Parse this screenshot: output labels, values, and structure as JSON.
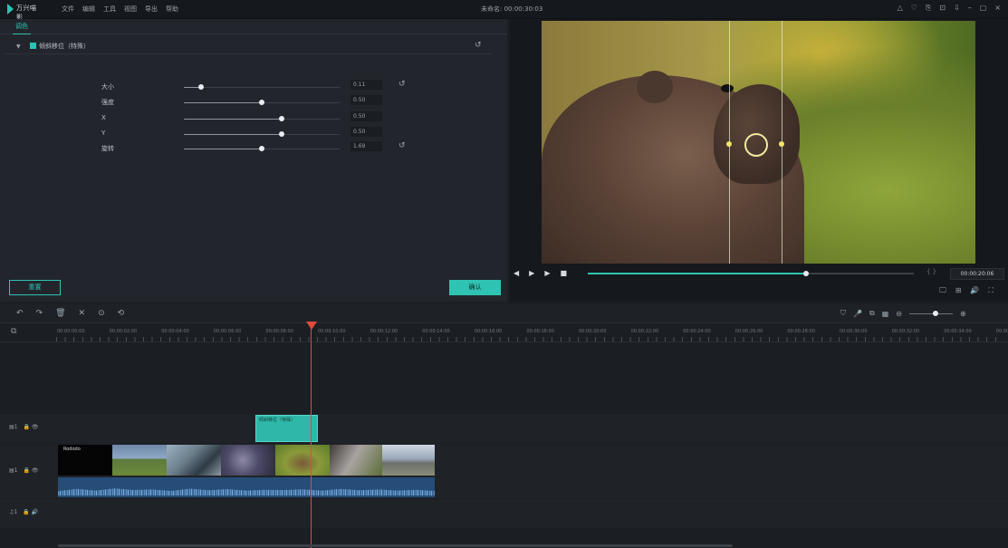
{
  "app": {
    "logo_text": "万兴喵影",
    "window_title": "未命名: 00:00:30:03"
  },
  "menu": [
    "文件",
    "编辑",
    "工具",
    "视图",
    "导出",
    "帮助"
  ],
  "window_controls": [
    "△",
    "♡",
    "⎘",
    "⊡",
    "⇩",
    "–",
    "▢",
    "×"
  ],
  "effect_panel": {
    "tab": "调色",
    "section_label": "倾斜移位（特殊）",
    "section_reset_icon": "reset-icon",
    "params": [
      {
        "label": "大小",
        "value": "0.11",
        "level": 0.11,
        "has_reset": true
      },
      {
        "label": "强度",
        "value": "0.50",
        "level": 0.5,
        "has_reset": false
      },
      {
        "label": "X",
        "value": "0.50",
        "level": 0.63,
        "has_reset": false
      },
      {
        "label": "Y",
        "value": "0.50",
        "level": 0.63,
        "has_reset": false
      },
      {
        "label": "旋转",
        "value": "1.69",
        "level": 0.5,
        "has_reset": true
      }
    ],
    "reset_button": "重置",
    "ok_button": "确认"
  },
  "preview": {
    "controls": [
      "◀",
      "▶",
      "▶",
      "■"
    ],
    "progress": 0.67,
    "bracket": "{ }",
    "timecode": "00:00:20:06",
    "bottom_icons": [
      "🖵",
      "⊞",
      "🔊",
      "⛶"
    ]
  },
  "timeline": {
    "tools_left": [
      "↶",
      "↷",
      "🗑",
      "✕",
      "⊙",
      "⟲"
    ],
    "tools_right": [
      "⛉",
      "🎤",
      "⧉",
      "▦",
      "⊖",
      "⊕"
    ],
    "ruler_icon": "⧉",
    "ruler_ticks": [
      "00:00:00:00",
      "00:00:02:00",
      "00:00:04:00",
      "00:00:06:00",
      "00:00:08:00",
      "00:00:10:00",
      "00:00:12:00",
      "00:00:14:00",
      "00:00:16:00",
      "00:00:18:00",
      "00:00:20:00",
      "00:00:22:00",
      "00:00:24:00",
      "00:00:26:00",
      "00:00:28:00",
      "00:00:30:00",
      "00:00:32:00",
      "00:00:34:00",
      "00:00:36:00"
    ],
    "tracks": [
      {
        "label": "▤1",
        "icons": "🔒 👁"
      },
      {
        "label": "▤1",
        "icons": "🔒 👁"
      },
      {
        "label": "♫1",
        "icons": "🔒 🔊"
      }
    ],
    "fx_clip_label": "倾斜移位（特殊）",
    "video_clip_first_label": "Rododo"
  },
  "colors": {
    "accent": "#2fc3b3",
    "playhead": "#e04a3f"
  }
}
